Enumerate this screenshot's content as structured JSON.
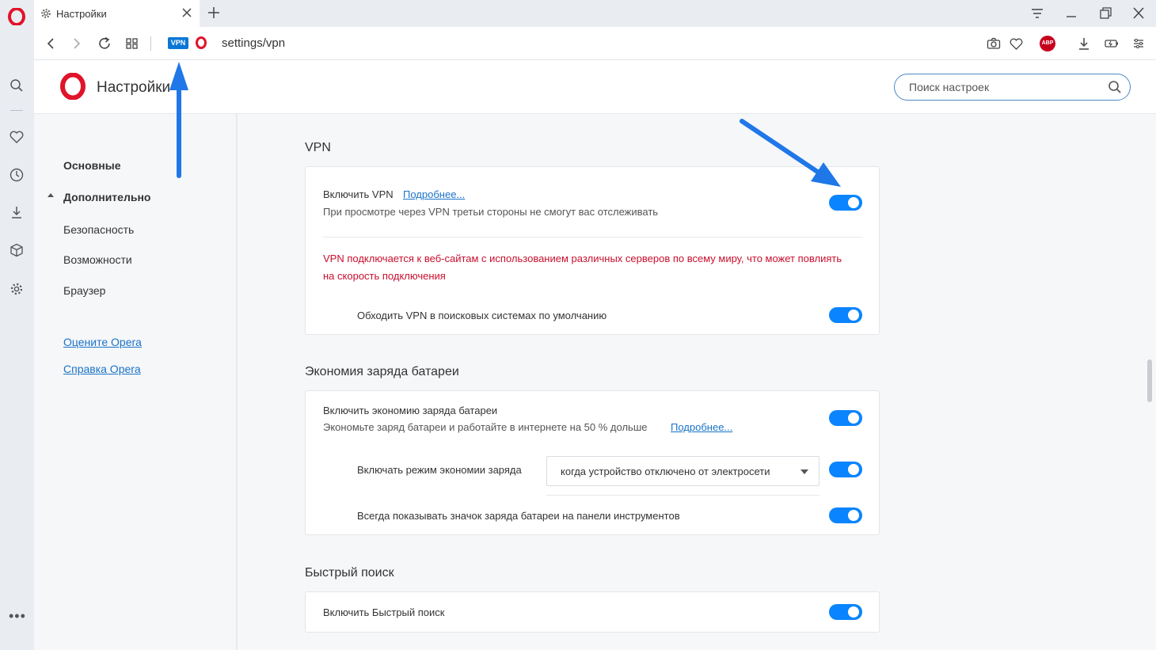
{
  "tab": {
    "title": "Настройки",
    "icon": "gear-icon",
    "close_icon": "close-icon"
  },
  "toolbar": {
    "vpn_badge": "VPN",
    "url": "settings/vpn",
    "abp_badge": "ABP"
  },
  "header": {
    "title": "Настройки",
    "search_placeholder": "Поиск настроек"
  },
  "nav": {
    "basic": "Основные",
    "advanced": "Дополнительно",
    "security": "Безопасность",
    "features": "Возможности",
    "browser": "Браузер",
    "rate_opera": "Оцените Opera",
    "help_opera": "Справка Opera"
  },
  "vpn": {
    "section_title": "VPN",
    "enable_label": "Включить VPN",
    "enable_more": "Подробнее...",
    "enable_desc": "При просмотре через VPN третьи стороны не смогут вас отслеживать",
    "enabled": true,
    "warning": "VPN подключается к веб-сайтам с использованием различных серверов по всему миру, что может повлиять на скорость подключения",
    "bypass_label": "Обходить VPN в поисковых системах по умолчанию",
    "bypass_enabled": true
  },
  "battery": {
    "section_title": "Экономия заряда батареи",
    "enable_label": "Включить экономию заряда батареи",
    "enable_desc": "Экономьте заряд батареи и работайте в интернете на 50 % дольше",
    "enable_more": "Подробнее...",
    "enabled": true,
    "mode_label": "Включать режим экономии заряда",
    "mode_value": "когда устройство отключено от электросети",
    "mode_enabled": true,
    "show_icon_label": "Всегда показывать значок заряда батареи на панели инструментов",
    "show_icon_enabled": true
  },
  "quick_search": {
    "section_title": "Быстрый поиск",
    "enable_label": "Включить Быстрый поиск",
    "enabled": true
  },
  "colors": {
    "accent": "#0a84ff",
    "link": "#1a73c8",
    "warning": "#c8102e",
    "opera_red": "#e0142a",
    "annotation_arrow": "#1f77e8"
  }
}
